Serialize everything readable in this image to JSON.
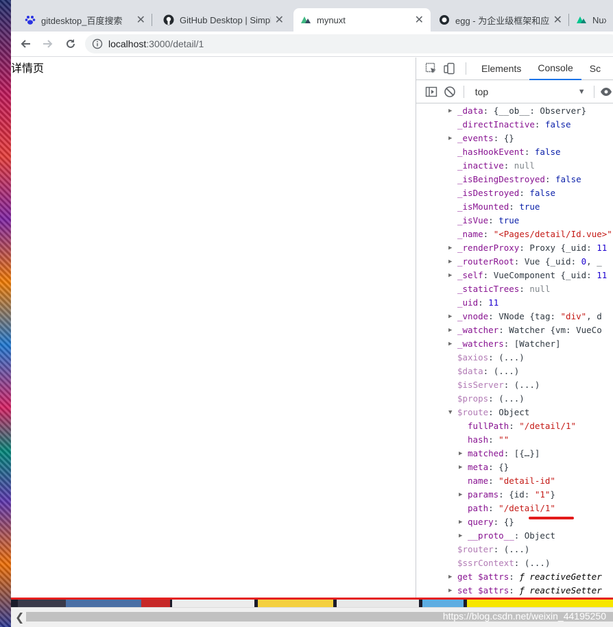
{
  "browser": {
    "tabs": [
      {
        "title": "gitdesktop_百度搜索",
        "icon": "baidu-paw-icon"
      },
      {
        "title": "GitHub Desktop | Simple",
        "icon": "github-icon"
      },
      {
        "title": "mynuxt",
        "icon": "nuxt-icon",
        "active": true
      },
      {
        "title": "egg - 为企业级框架和应用",
        "icon": "egg-icon"
      },
      {
        "title": "Nuxt",
        "icon": "nuxt-icon"
      }
    ],
    "url_host": "localhost",
    "url_path": ":3000/detail/1"
  },
  "page": {
    "title": "详情页"
  },
  "devtools": {
    "tabs": [
      "Elements",
      "Console",
      "Sc"
    ],
    "active_tab": "Console",
    "context": "top",
    "lines": [
      {
        "arrow": "right",
        "indent": 0,
        "key": "_data",
        "rest": [
          [
            "p",
            ": {__ob__: Observer}"
          ]
        ]
      },
      {
        "indent": 0,
        "key": "_directInactive",
        "rest": [
          [
            "p",
            ": "
          ],
          [
            "kw",
            "false"
          ]
        ]
      },
      {
        "arrow": "right",
        "indent": 0,
        "key": "_events",
        "rest": [
          [
            "p",
            ": {}"
          ]
        ]
      },
      {
        "indent": 0,
        "key": "_hasHookEvent",
        "rest": [
          [
            "p",
            ": "
          ],
          [
            "kw",
            "false"
          ]
        ]
      },
      {
        "indent": 0,
        "key": "_inactive",
        "rest": [
          [
            "p",
            ": "
          ],
          [
            "gray",
            "null"
          ]
        ]
      },
      {
        "indent": 0,
        "key": "_isBeingDestroyed",
        "rest": [
          [
            "p",
            ": "
          ],
          [
            "kw",
            "false"
          ]
        ]
      },
      {
        "indent": 0,
        "key": "_isDestroyed",
        "rest": [
          [
            "p",
            ": "
          ],
          [
            "kw",
            "false"
          ]
        ]
      },
      {
        "indent": 0,
        "key": "_isMounted",
        "rest": [
          [
            "p",
            ": "
          ],
          [
            "kw",
            "true"
          ]
        ]
      },
      {
        "indent": 0,
        "key": "_isVue",
        "rest": [
          [
            "p",
            ": "
          ],
          [
            "kw",
            "true"
          ]
        ]
      },
      {
        "indent": 0,
        "key": "_name",
        "rest": [
          [
            "p",
            ": "
          ],
          [
            "str",
            "\"<Pages/detail/Id.vue>\""
          ]
        ]
      },
      {
        "arrow": "right",
        "indent": 0,
        "key": "_renderProxy",
        "rest": [
          [
            "p",
            ": Proxy {_uid: "
          ],
          [
            "num",
            "11"
          ]
        ]
      },
      {
        "arrow": "right",
        "indent": 0,
        "key": "_routerRoot",
        "rest": [
          [
            "p",
            ": Vue {_uid: "
          ],
          [
            "num",
            "0"
          ],
          [
            "p",
            ", _"
          ]
        ]
      },
      {
        "arrow": "right",
        "indent": 0,
        "key": "_self",
        "rest": [
          [
            "p",
            ": VueComponent {_uid: "
          ],
          [
            "num",
            "11"
          ]
        ]
      },
      {
        "indent": 0,
        "key": "_staticTrees",
        "rest": [
          [
            "p",
            ": "
          ],
          [
            "gray",
            "null"
          ]
        ]
      },
      {
        "indent": 0,
        "key": "_uid",
        "rest": [
          [
            "p",
            ": "
          ],
          [
            "num",
            "11"
          ]
        ]
      },
      {
        "arrow": "right",
        "indent": 0,
        "key": "_vnode",
        "rest": [
          [
            "p",
            ": VNode {tag: "
          ],
          [
            "str",
            "\"div\""
          ],
          [
            "p",
            ", d"
          ]
        ]
      },
      {
        "arrow": "right",
        "indent": 0,
        "key": "_watcher",
        "rest": [
          [
            "p",
            ": Watcher {vm: VueCo"
          ]
        ]
      },
      {
        "arrow": "right",
        "indent": 0,
        "key": "_watchers",
        "rest": [
          [
            "p",
            ": [Watcher]"
          ]
        ]
      },
      {
        "indent": 0,
        "key": "$axios",
        "dim": true,
        "rest": [
          [
            "p",
            ": (...)"
          ]
        ]
      },
      {
        "indent": 0,
        "key": "$data",
        "dim": true,
        "rest": [
          [
            "p",
            ": (...)"
          ]
        ]
      },
      {
        "indent": 0,
        "key": "$isServer",
        "dim": true,
        "rest": [
          [
            "p",
            ": (...)"
          ]
        ]
      },
      {
        "indent": 0,
        "key": "$props",
        "dim": true,
        "rest": [
          [
            "p",
            ": (...)"
          ]
        ]
      },
      {
        "arrow": "down",
        "indent": 0,
        "key": "$route",
        "dim": true,
        "rest": [
          [
            "p",
            ": Object"
          ]
        ]
      },
      {
        "indent": 1,
        "key": "fullPath",
        "rest": [
          [
            "p",
            ": "
          ],
          [
            "str",
            "\"/detail/1\""
          ]
        ]
      },
      {
        "indent": 1,
        "key": "hash",
        "rest": [
          [
            "p",
            ": "
          ],
          [
            "str",
            "\"\""
          ]
        ]
      },
      {
        "arrow": "right",
        "indent": 1,
        "key": "matched",
        "rest": [
          [
            "p",
            ": [{…}]"
          ]
        ]
      },
      {
        "arrow": "right",
        "indent": 1,
        "key": "meta",
        "rest": [
          [
            "p",
            ": {}"
          ]
        ]
      },
      {
        "indent": 1,
        "key": "name",
        "rest": [
          [
            "p",
            ": "
          ],
          [
            "str",
            "\"detail-id\""
          ]
        ]
      },
      {
        "arrow": "right",
        "indent": 1,
        "key": "params",
        "rest": [
          [
            "p",
            ": {id: "
          ],
          [
            "str",
            "\"1\""
          ],
          [
            "p",
            "}"
          ]
        ]
      },
      {
        "indent": 1,
        "key": "path",
        "rest": [
          [
            "p",
            ": "
          ],
          [
            "str",
            "\"/detail/1\""
          ]
        ]
      },
      {
        "arrow": "right",
        "indent": 1,
        "key": "query",
        "rest": [
          [
            "p",
            ": {}"
          ]
        ]
      },
      {
        "arrow": "right",
        "indent": 1,
        "key": "__proto__",
        "rest": [
          [
            "p",
            ": Object"
          ]
        ]
      },
      {
        "indent": 0,
        "key": "$router",
        "dim": true,
        "rest": [
          [
            "p",
            ": (...)"
          ]
        ]
      },
      {
        "indent": 0,
        "key": "$ssrContext",
        "dim": true,
        "rest": [
          [
            "p",
            ": (...)"
          ]
        ]
      },
      {
        "arrow": "right",
        "indent": 0,
        "key": "get $attrs",
        "rest": [
          [
            "p",
            ": "
          ],
          [
            "ital",
            "ƒ reactiveGetter"
          ]
        ]
      },
      {
        "arrow": "right",
        "indent": 0,
        "key": "set $attrs",
        "rest": [
          [
            "p",
            ": "
          ],
          [
            "ital",
            "ƒ reactiveSetter"
          ]
        ]
      }
    ]
  },
  "watermark": "https://blog.csdn.net/weixin_44195250",
  "colors": {
    "accent": "#1a73e8",
    "underline_mark": "#e31b1b"
  }
}
